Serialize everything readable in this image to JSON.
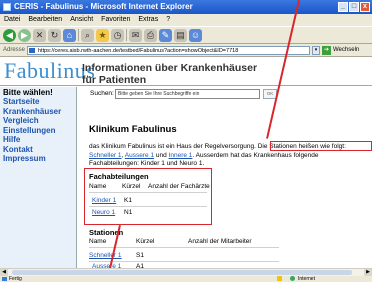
{
  "window": {
    "title": "CERIS - Fabulinus - Microsoft Internet Explorer",
    "buttons": [
      "_",
      "□",
      "x"
    ]
  },
  "menu": [
    "Datei",
    "Bearbeiten",
    "Ansicht",
    "Favoriten",
    "Extras",
    "?"
  ],
  "address": {
    "label": "Adresse",
    "url": "https://ceres.aisb.rwth-aachen.de/testbed/Fabulinus?action=showObject&ID=7718",
    "go_label": "Wechseln"
  },
  "header": {
    "logo": "Fabulinus",
    "title_line1": "Informationen über Krankenhäuser",
    "title_line2": "für Patienten"
  },
  "sidebar": {
    "heading": "Bitte wählen!",
    "items": [
      "Startseite",
      "Krankenhäuser",
      "Vergleich",
      "Einstellungen",
      "Hilfe",
      "Kontakt",
      "Impressum"
    ]
  },
  "search": {
    "label": "Suchen:",
    "placeholder": "Bitte geben Sie Ihre Suchbegriffe ein",
    "button": "OK"
  },
  "main": {
    "heading": "Klinikum Fabulinus",
    "para_line1_a": "das Klinikum Fabulinus ist ein Haus der Regelversorgung.",
    "para_line1_b": "Die Stationen heißen wie folgt:",
    "link_schneller": "Schneller 1",
    "link_aussere": "Aussere 1",
    "link_innere": "Innere 1",
    "para_line2_a": ", ",
    "para_line2_b": " und ",
    "para_line2_c": ". Ausserdem hat das Krankenhaus folgende",
    "para_line3": "Fachabteilungen: Kinder 1 und Neuro 1."
  },
  "fachabteilungen": {
    "title": "Fachabteilungen",
    "headers": [
      "Name",
      "Kürzel",
      "Anzahl der Fachärzte"
    ],
    "rows": [
      {
        "name": "Kinder 1",
        "code": "K1"
      },
      {
        "name": "Neuro 1",
        "code": "N1"
      }
    ]
  },
  "stationen": {
    "title": "Stationen",
    "headers": [
      "Name",
      "Kürzel",
      "Anzahl der Mitarbeiter"
    ],
    "rows": [
      {
        "name": "Schneller 1",
        "code": "S1"
      },
      {
        "name": "Aussere 1",
        "code": "A1"
      }
    ]
  },
  "status": {
    "left": "Fertig",
    "right": "Internet"
  },
  "annotation_color": "#d9262c"
}
